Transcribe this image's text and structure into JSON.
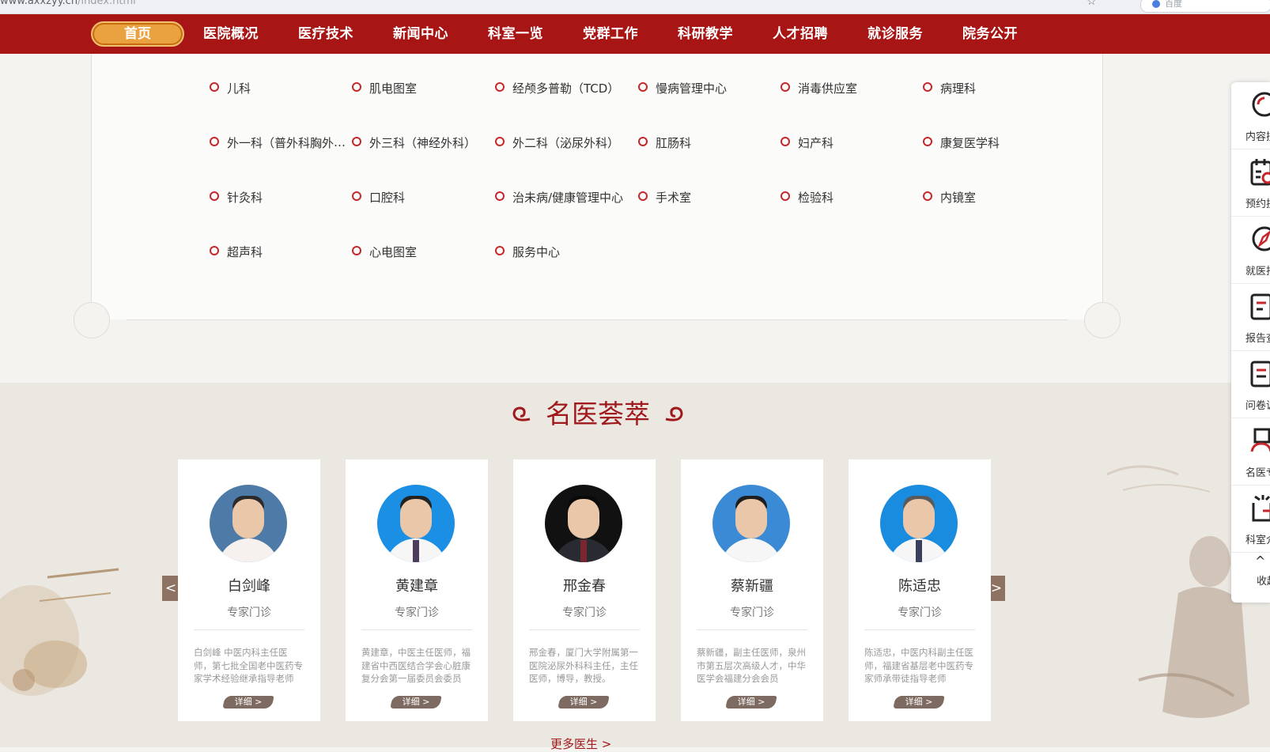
{
  "browser": {
    "url_host": "www.axxzyy.cn",
    "url_path": "/index.html",
    "search_label": "百度"
  },
  "nav": {
    "items": [
      "首页",
      "医院概况",
      "医疗技术",
      "新闻中心",
      "科室一览",
      "党群工作",
      "科研教学",
      "人才招聘",
      "就诊服务",
      "院务公开"
    ]
  },
  "departments": [
    [
      "儿科",
      "肌电图室",
      "经颅多普勒（TCD）",
      "慢病管理中心",
      "消毒供应室",
      "病理科"
    ],
    [
      "外一科（普外科胸外科）",
      "外三科（神经外科）",
      "外二科（泌尿外科）",
      "肛肠科",
      "妇产科",
      "康复医学科"
    ],
    [
      "针灸科",
      "口腔科",
      "治未病/健康管理中心",
      "手术室",
      "检验科",
      "内镜室"
    ],
    [
      "超声科",
      "心电图室",
      "服务中心"
    ]
  ],
  "doctors_section": {
    "title": "名医荟萃",
    "prev": "<",
    "next": ">",
    "more": "更多医生 >",
    "detail_label": "详细 >",
    "doctors": [
      {
        "name": "白剑峰",
        "type": "专家门诊",
        "desc": "白剑峰 中医内科主任医师，第七批全国老中医药专家学术经验继承指导老师"
      },
      {
        "name": "黄建章",
        "type": "专家门诊",
        "desc": "黄建章，中医主任医师，福建省中西医结合学会心脏康复分会第一届委员会委员"
      },
      {
        "name": "邢金春",
        "type": "专家门诊",
        "desc": "邢金春，厦门大学附属第一医院泌尿外科科主任，主任医师，博导，教授。"
      },
      {
        "name": "蔡新疆",
        "type": "专家门诊",
        "desc": "蔡新疆，副主任医师，泉州市第五层次高级人才，中华医学会福建分会会员"
      },
      {
        "name": "陈适忠",
        "type": "专家门诊",
        "desc": "陈适忠，中医内科副主任医师，福建省基层老中医药专家师承带徒指导老师"
      }
    ]
  },
  "sidebar": {
    "items": [
      "内容搜索",
      "预约挂号",
      "就医指南",
      "报告查询",
      "问卷调查",
      "名医专家",
      "科室介绍"
    ],
    "collapse": "收起"
  },
  "colors": {
    "nav_red": "#a81515",
    "home_orange": "#e9a23f",
    "accent_red": "#c7262a"
  }
}
